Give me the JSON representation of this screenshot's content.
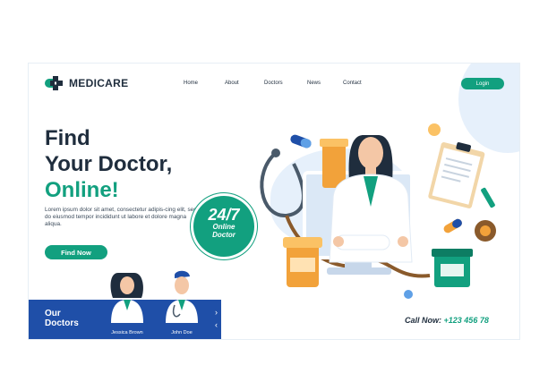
{
  "brand": {
    "name": "MEDICARE"
  },
  "nav": {
    "items": [
      "Home",
      "About",
      "Doctors",
      "News",
      "Contact"
    ]
  },
  "header": {
    "login_label": "Login"
  },
  "hero": {
    "line1": "Find",
    "line2": "Your Doctor,",
    "line3": "Online!",
    "lead": "Lorem ipsum dolor sit amet, consectetur adipis-cing elit, sed do eiusmod tempor incididunt ut labore et dolore magna aliqua.",
    "cta_label": "Find Now"
  },
  "badge": {
    "big": "24/7",
    "line1": "Online",
    "line2": "Doctor"
  },
  "doctors_panel": {
    "title_line1": "Our",
    "title_line2": "Doctors",
    "cards": [
      {
        "name": "Jessica Brown"
      },
      {
        "name": "John Doe"
      }
    ]
  },
  "footer": {
    "call_label": "Call Now:",
    "phone": "+123 456 78"
  },
  "colors": {
    "accent": "#12a07f",
    "navy": "#1f4fa8",
    "text": "#1f2d3d",
    "blob": "#e6f0fb"
  }
}
